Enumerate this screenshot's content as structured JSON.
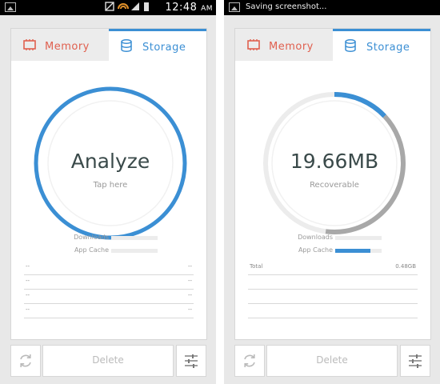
{
  "colors": {
    "accent": "#3b8fd4",
    "memory": "#e0604f",
    "track": "#ececec",
    "used_arc": "#a8a8a8"
  },
  "phones": [
    {
      "status_bar": {
        "time": "12:48",
        "ampm": "AM",
        "notification": ""
      },
      "tabs": {
        "memory": "Memory",
        "storage": "Storage",
        "active": "storage"
      },
      "gauge": {
        "title": "Analyze",
        "subtitle": "Tap here",
        "progress": 1.0
      },
      "legend": [
        {
          "label": "Downloads",
          "fill": 0.0
        },
        {
          "label": "App Cache",
          "fill": 0.0
        }
      ],
      "list": [
        {
          "left": "--",
          "right": "--"
        },
        {
          "left": "--",
          "right": "--"
        },
        {
          "left": "--",
          "right": "--"
        },
        {
          "left": "--",
          "right": "--"
        }
      ],
      "buttons": {
        "delete": "Delete"
      }
    },
    {
      "status_bar": {
        "time": "",
        "ampm": "",
        "notification": "Saving screenshot..."
      },
      "tabs": {
        "memory": "Memory",
        "storage": "Storage",
        "active": "storage"
      },
      "gauge": {
        "title": "19.66MB",
        "subtitle": "Recoverable",
        "recoverable_fraction": 0.13,
        "used_fraction": 0.39
      },
      "legend": [
        {
          "label": "Downloads",
          "fill": 0.0
        },
        {
          "label": "App Cache",
          "fill": 0.75
        }
      ],
      "list": [
        {
          "left": "Total",
          "right": "0.48GB"
        },
        {
          "left": "",
          "right": ""
        },
        {
          "left": "",
          "right": ""
        },
        {
          "left": "",
          "right": ""
        }
      ],
      "buttons": {
        "delete": "Delete"
      }
    }
  ]
}
